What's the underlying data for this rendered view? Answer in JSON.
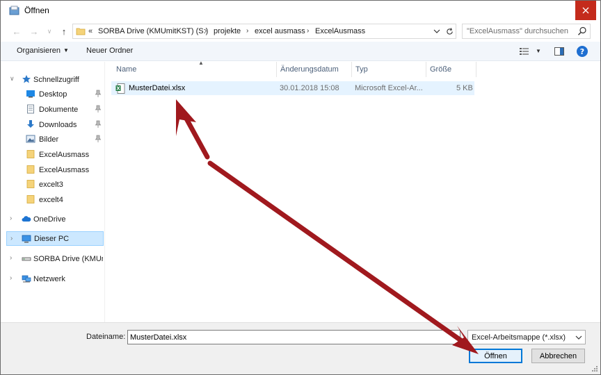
{
  "window": {
    "title": "Öffnen"
  },
  "address": {
    "chevrons": "«",
    "crumbs": [
      "SORBA Drive (KMUmitKST) (S:)",
      "projekte",
      "excel ausmass",
      "ExcelAusmass"
    ]
  },
  "search": {
    "placeholder": "\"ExcelAusmass\" durchsuchen"
  },
  "toolbar": {
    "organize_label": "Organisieren",
    "new_folder_label": "Neuer Ordner"
  },
  "sidebar": {
    "quick_access": "Schnellzugriff",
    "items": [
      {
        "label": "Desktop",
        "icon": "desktop-icon"
      },
      {
        "label": "Dokumente",
        "icon": "documents-icon"
      },
      {
        "label": "Downloads",
        "icon": "downloads-icon"
      },
      {
        "label": "Bilder",
        "icon": "pictures-icon"
      },
      {
        "label": "ExcelAusmass",
        "icon": "folder-icon"
      },
      {
        "label": "ExcelAusmass",
        "icon": "folder-icon"
      },
      {
        "label": "excelt3",
        "icon": "folder-icon"
      },
      {
        "label": "excelt4",
        "icon": "folder-icon"
      }
    ],
    "onedrive": "OneDrive",
    "this_pc": "Dieser PC",
    "sorba_drive": "SORBA Drive (KMUmitKST) (S:)",
    "network": "Netzwerk"
  },
  "columns": {
    "name": "Name",
    "date": "Änderungsdatum",
    "type": "Typ",
    "size": "Größe"
  },
  "files": [
    {
      "name": "MusterDatei.xlsx",
      "date": "30.01.2018 15:08",
      "type": "Microsoft Excel-Ar...",
      "size": "5 KB"
    }
  ],
  "bottom": {
    "filename_label": "Dateiname:",
    "filename_value": "MusterDatei.xlsx",
    "filetype_value": "Excel-Arbeitsmappe (*.xlsx)",
    "open_label": "Öffnen",
    "cancel_label": "Abbrechen"
  },
  "colors": {
    "accent": "#0078d7",
    "selection": "#cce8ff",
    "close_red": "#c42b1c",
    "annotation_arrow": "#a0191e"
  }
}
